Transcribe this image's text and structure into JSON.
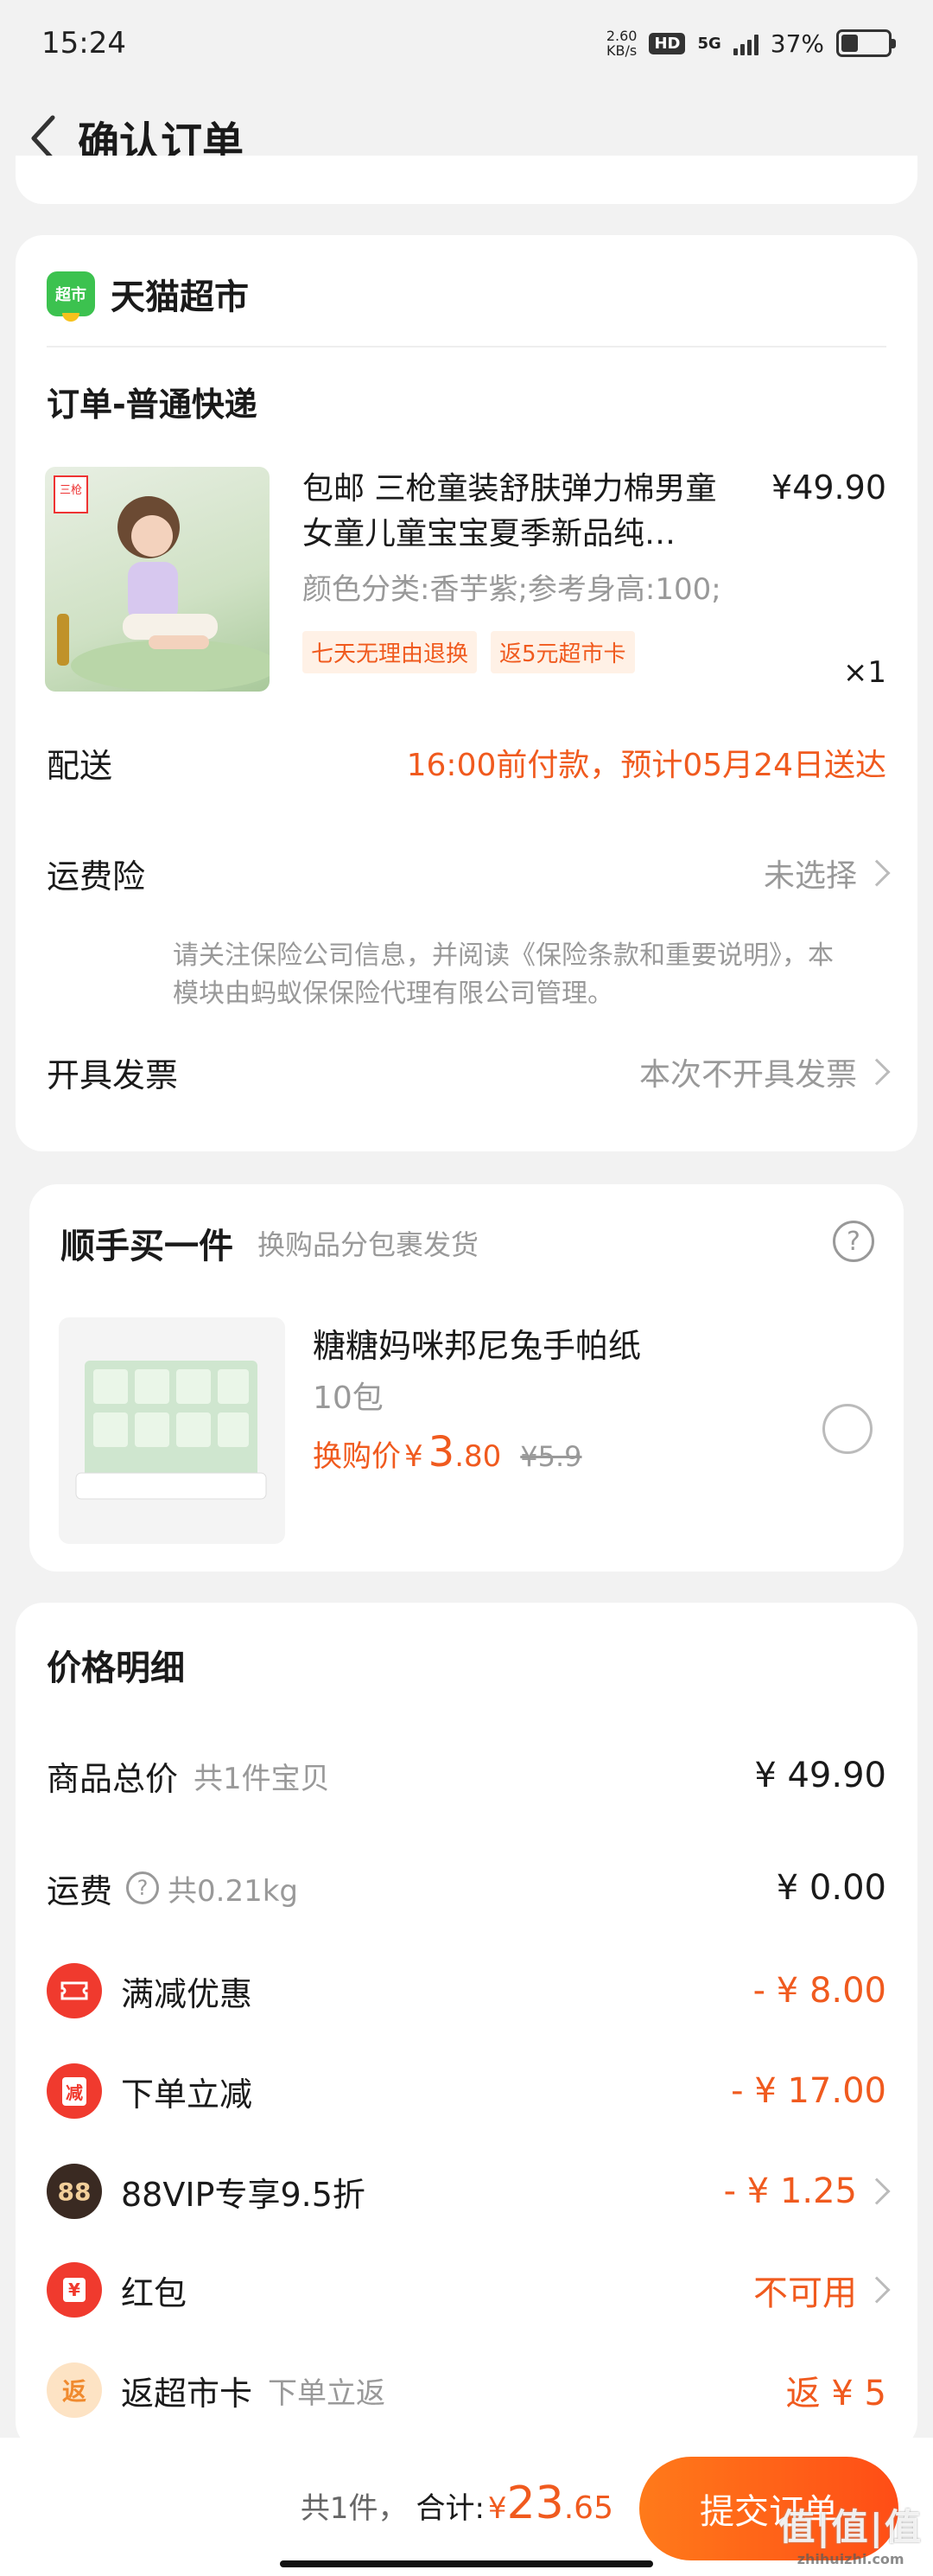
{
  "status_bar": {
    "time": "15:24",
    "net_speed_value": "2.60",
    "net_speed_unit": "KB/s",
    "hd": "HD",
    "network": "5G",
    "battery": "37%"
  },
  "nav": {
    "title": "确认订单"
  },
  "store": {
    "logo_text": "超市",
    "name": "天猫超市"
  },
  "order": {
    "section_title": "订单-普通快递",
    "product": {
      "brand_tag": "三枪",
      "title": "包邮 三枪童装舒肤弹力棉男童女童儿童宝宝夏季新品纯…",
      "price": "¥49.90",
      "spec": "颜色分类:香芋紫;参考身高:100;",
      "tags": [
        "七天无理由退换",
        "返5元超市卡"
      ],
      "quantity": "×1"
    },
    "delivery_label": "配送",
    "delivery_value": "16:00前付款，预计05月24日送达",
    "insurance_label": "运费险",
    "insurance_value": "未选择",
    "insurance_note": "请关注保险公司信息，并阅读《保险条款和重要说明》，本模块由蚂蚁保保险代理有限公司管理。",
    "invoice_label": "开具发票",
    "invoice_value": "本次不开具发票"
  },
  "addon": {
    "title": "顺手买一件",
    "subtitle": "换购品分包裹发货",
    "help_icon": "?",
    "item_name": "糖糖妈咪邦尼兔手帕纸",
    "item_spec": "10包",
    "price_label": "换购价",
    "price_symbol": "¥",
    "price_int": "3",
    "price_dec": ".80",
    "original_price": "¥5.9"
  },
  "price_detail": {
    "title": "价格明细",
    "items_label": "商品总价",
    "items_count": "共1件宝贝",
    "items_total": "¥ 49.90",
    "shipping_label": "运费",
    "shipping_weight": "共0.21kg",
    "shipping_value": "¥ 0.00",
    "discounts": [
      {
        "icon": "ticket-icon",
        "icon_text": "",
        "color": "#f03a2e",
        "label": "满减优惠",
        "sub": "",
        "value": "- ¥ 8.00",
        "chevron": false
      },
      {
        "icon": "reduce-icon",
        "icon_text": "减",
        "color": "#f03a2e",
        "label": "下单立减",
        "sub": "",
        "value": "- ¥ 17.00",
        "chevron": false
      },
      {
        "icon": "vip-88-icon",
        "icon_text": "88",
        "color": "#3a2a22",
        "label": "88VIP专享9.5折",
        "sub": "",
        "value": "- ¥ 1.25",
        "chevron": true
      },
      {
        "icon": "red-packet-icon",
        "icon_text": "¥",
        "color": "#f03a2e",
        "label": "红包",
        "sub": "",
        "value": "不可用",
        "chevron": true
      },
      {
        "icon": "rebate-icon",
        "icon_text": "返",
        "color": "#fde3c4",
        "label": "返超市卡",
        "sub": "下单立返",
        "value": "返 ¥ 5",
        "chevron": false
      }
    ]
  },
  "bottom": {
    "count": "共1件，",
    "total_label": "合计:",
    "total_symbol": "¥",
    "total_int": "23",
    "total_dec": ".65",
    "submit": "提交订单"
  },
  "watermark": {
    "main": "值|值|值",
    "sub": "zhihuizhi.com"
  }
}
